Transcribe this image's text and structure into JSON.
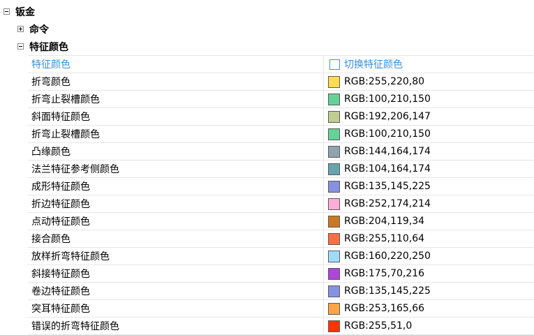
{
  "tree": {
    "root_label": "钣金",
    "commands_label": "命令",
    "feature_colors_label": "特征颜色"
  },
  "grid": {
    "header_name": "特征颜色",
    "header_toggle": "切换特征颜色",
    "rows": [
      {
        "name": "折弯颜色",
        "value": "RGB:255,220,80",
        "color": "#ffdc50"
      },
      {
        "name": "折弯止裂槽颜色",
        "value": "RGB:100,210,150",
        "color": "#64d296"
      },
      {
        "name": "斜面特征颜色",
        "value": "RGB:192,206,147",
        "color": "#c0ce93"
      },
      {
        "name": "折弯止裂槽颜色",
        "value": "RGB:100,210,150",
        "color": "#64d296"
      },
      {
        "name": "凸缘颜色",
        "value": "RGB:144,164,174",
        "color": "#90a4ae"
      },
      {
        "name": "法兰特征参考侧颜色",
        "value": "RGB:104,164,174",
        "color": "#68a4ae"
      },
      {
        "name": "成形特征颜色",
        "value": "RGB:135,145,225",
        "color": "#8791e1"
      },
      {
        "name": "折边特征颜色",
        "value": "RGB:252,174,214",
        "color": "#fcaed6"
      },
      {
        "name": "点动特征颜色",
        "value": "RGB:204,119,34",
        "color": "#cc7722"
      },
      {
        "name": "接合颜色",
        "value": "RGB:255,110,64",
        "color": "#ff6e40"
      },
      {
        "name": "放样折弯特征颜色",
        "value": "RGB:160,220,250",
        "color": "#a0dcfa"
      },
      {
        "name": "斜接特征颜色",
        "value": "RGB:175,70,216",
        "color": "#af46d8"
      },
      {
        "name": "卷边特征颜色",
        "value": "RGB:135,145,225",
        "color": "#8791e1"
      },
      {
        "name": "突耳特征颜色",
        "value": "RGB:253,165,66",
        "color": "#fda542"
      },
      {
        "name": "错误的折弯特征颜色",
        "value": "RGB:255,51,0",
        "color": "#ff3300"
      }
    ]
  }
}
